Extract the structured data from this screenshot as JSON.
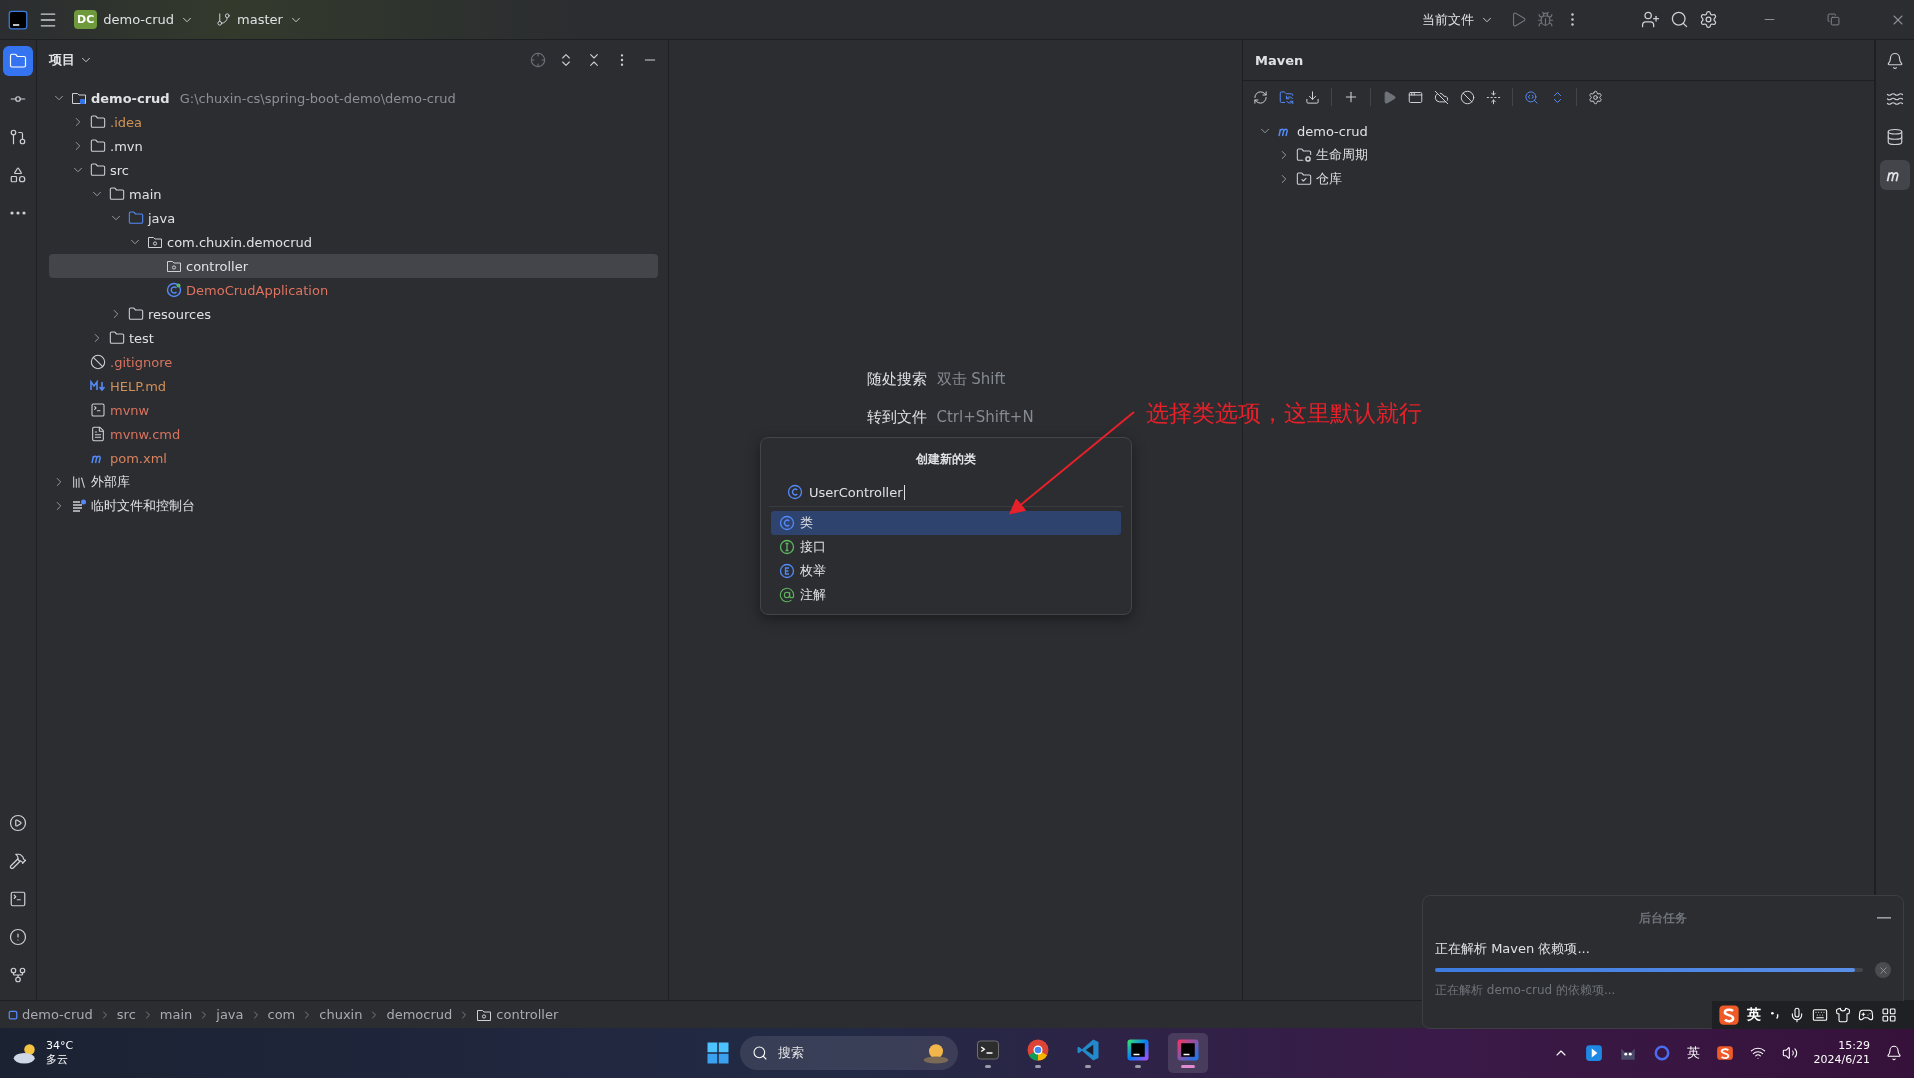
{
  "title_bar": {
    "badge": "DC",
    "project": "demo-crud",
    "branch": "master",
    "run_config": "当前文件"
  },
  "left_tools": [
    {
      "kind": "project",
      "selected": true
    },
    {
      "kind": "commit",
      "selected": false
    },
    {
      "kind": "pull-requests",
      "selected": false
    },
    {
      "kind": "structure",
      "selected": false
    },
    {
      "kind": "more",
      "selected": false
    }
  ],
  "left_tools_bottom": [
    {
      "kind": "services"
    },
    {
      "kind": "build"
    },
    {
      "kind": "terminal"
    },
    {
      "kind": "problems"
    },
    {
      "kind": "git"
    }
  ],
  "right_tools": [
    {
      "kind": "notifications",
      "selected": false
    },
    {
      "kind": "ai",
      "selected": false
    },
    {
      "kind": "database",
      "selected": false
    },
    {
      "kind": "maven",
      "selected": true
    }
  ],
  "project_panel": {
    "title": "项目",
    "tree": [
      {
        "label": "demo-crud",
        "path": "G:\\chuxin-cs\\spring-boot-demo\\demo-crud",
        "kind": "module",
        "bold": true,
        "color": "#dfe1e5",
        "selected": false,
        "expanded": true,
        "children": [
          {
            "label": ".idea",
            "kind": "folder",
            "color": "#d0935a",
            "selected": false,
            "expanded": false
          },
          {
            "label": ".mvn",
            "kind": "folder",
            "color": "#dfe1e5",
            "selected": false,
            "expanded": false
          },
          {
            "label": "src",
            "kind": "folder",
            "color": "#dfe1e5",
            "selected": false,
            "expanded": true,
            "children": [
              {
                "label": "main",
                "kind": "folder",
                "color": "#dfe1e5",
                "selected": false,
                "expanded": true,
                "children": [
                  {
                    "label": "java",
                    "kind": "source-folder",
                    "color": "#dfe1e5",
                    "selected": false,
                    "expanded": true,
                    "children": [
                      {
                        "label": "com.chuxin.democrud",
                        "kind": "package",
                        "color": "#dfe1e5",
                        "selected": false,
                        "expanded": true,
                        "children": [
                          {
                            "label": "controller",
                            "kind": "package",
                            "color": "#dfe1e5",
                            "selected": true
                          },
                          {
                            "label": "DemoCrudApplication",
                            "kind": "spring-class",
                            "color": "#e0735f",
                            "selected": false
                          }
                        ]
                      }
                    ]
                  },
                  {
                    "label": "resources",
                    "kind": "folder",
                    "color": "#dfe1e5",
                    "selected": false,
                    "expanded": false
                  }
                ]
              },
              {
                "label": "test",
                "kind": "folder",
                "color": "#dfe1e5",
                "selected": false,
                "expanded": false
              }
            ]
          },
          {
            "label": ".gitignore",
            "kind": "ignore",
            "color": "#d9735f",
            "selected": false
          },
          {
            "label": "HELP.md",
            "kind": "markdown",
            "color": "#d0905a",
            "selected": false
          },
          {
            "label": "mvnw",
            "kind": "script",
            "color": "#d9735f",
            "selected": false
          },
          {
            "label": "mvnw.cmd",
            "kind": "text",
            "color": "#d9735f",
            "selected": false
          },
          {
            "label": "pom.xml",
            "kind": "maven",
            "color": "#d9835f",
            "selected": false
          }
        ]
      },
      {
        "label": "外部库",
        "kind": "library",
        "color": "#dfe1e5",
        "selected": false,
        "expanded": false
      },
      {
        "label": "临时文件和控制台",
        "kind": "scratch",
        "color": "#dfe1e5",
        "selected": false,
        "expanded": false
      }
    ]
  },
  "editor": {
    "hints": [
      {
        "label": "随处搜索",
        "shortcut": "双击 Shift"
      },
      {
        "label": "转到文件",
        "shortcut": "Ctrl+Shift+N"
      }
    ]
  },
  "dialog": {
    "title": "创建新的类",
    "value": "UserController",
    "options": [
      {
        "label": "类",
        "kind": "class",
        "selected": true
      },
      {
        "label": "接口",
        "kind": "interface",
        "selected": false
      },
      {
        "label": "枚举",
        "kind": "enum",
        "selected": false
      },
      {
        "label": "注解",
        "kind": "annotation",
        "selected": false
      }
    ]
  },
  "annotation": {
    "text": "选择类选项，这里默认就行"
  },
  "maven_panel": {
    "title": "Maven",
    "tree": [
      {
        "label": "demo-crud",
        "kind": "maven",
        "selected": false,
        "expanded": true,
        "children": [
          {
            "label": "生命周期",
            "kind": "lifecycle",
            "selected": false,
            "expanded": false
          },
          {
            "label": "仓库",
            "kind": "repository",
            "selected": false,
            "expanded": false
          }
        ]
      }
    ]
  },
  "breadcrumbs": [
    {
      "label": "demo-crud",
      "kind": "module"
    },
    {
      "label": "src",
      "kind": "plain"
    },
    {
      "label": "main",
      "kind": "plain"
    },
    {
      "label": "java",
      "kind": "plain"
    },
    {
      "label": "com",
      "kind": "plain"
    },
    {
      "label": "chuxin",
      "kind": "plain"
    },
    {
      "label": "democrud",
      "kind": "plain"
    },
    {
      "label": "controller",
      "kind": "package"
    }
  ],
  "background_tasks": {
    "title": "后台任务",
    "task": "正在解析 Maven 依赖项...",
    "level": 0.98,
    "detail": "正在解析 demo-crud 的依赖项..."
  },
  "ime_bar": {
    "lang": "英"
  },
  "taskbar": {
    "weather": {
      "temp": "34°C",
      "desc": "多云"
    },
    "search": "搜索",
    "apps": [
      {
        "kind": "terminal",
        "selected": false
      },
      {
        "kind": "browser",
        "selected": false
      },
      {
        "kind": "code-editor",
        "selected": false
      },
      {
        "kind": "go-ide",
        "selected": false
      },
      {
        "kind": "java-ide",
        "selected": true
      }
    ],
    "input_lang": "英",
    "time": "15:29",
    "date": "2024/6/21"
  }
}
